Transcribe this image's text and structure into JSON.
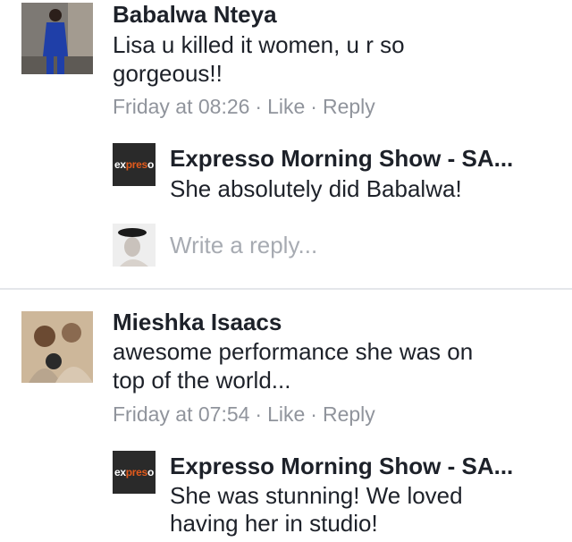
{
  "comments": [
    {
      "author": "Babalwa Nteya",
      "text_lines": [
        "Lisa u killed it women, u r so",
        "gorgeous!!"
      ],
      "time": "Friday at 08:26",
      "like": "Like",
      "reply": "Reply",
      "separator": "·",
      "reply_item": {
        "author": "Expresso Morning Show - SA...",
        "text_lines": [
          "She absolutely did Babalwa!"
        ],
        "logo_text_a": "ex",
        "logo_text_b": "pres",
        "logo_text_c": "o"
      },
      "write_reply_placeholder": "Write a reply..."
    },
    {
      "author": "Mieshka Isaacs",
      "text_lines": [
        "awesome performance she was on",
        "top of the world..."
      ],
      "time": "Friday at 07:54",
      "like": "Like",
      "reply": "Reply",
      "separator": "·",
      "reply_item": {
        "author": "Expresso Morning Show - SA...",
        "text_lines": [
          "She was stunning! We loved",
          "having her in studio!"
        ],
        "logo_text_a": "ex",
        "logo_text_b": "pres",
        "logo_text_c": "o"
      }
    }
  ]
}
